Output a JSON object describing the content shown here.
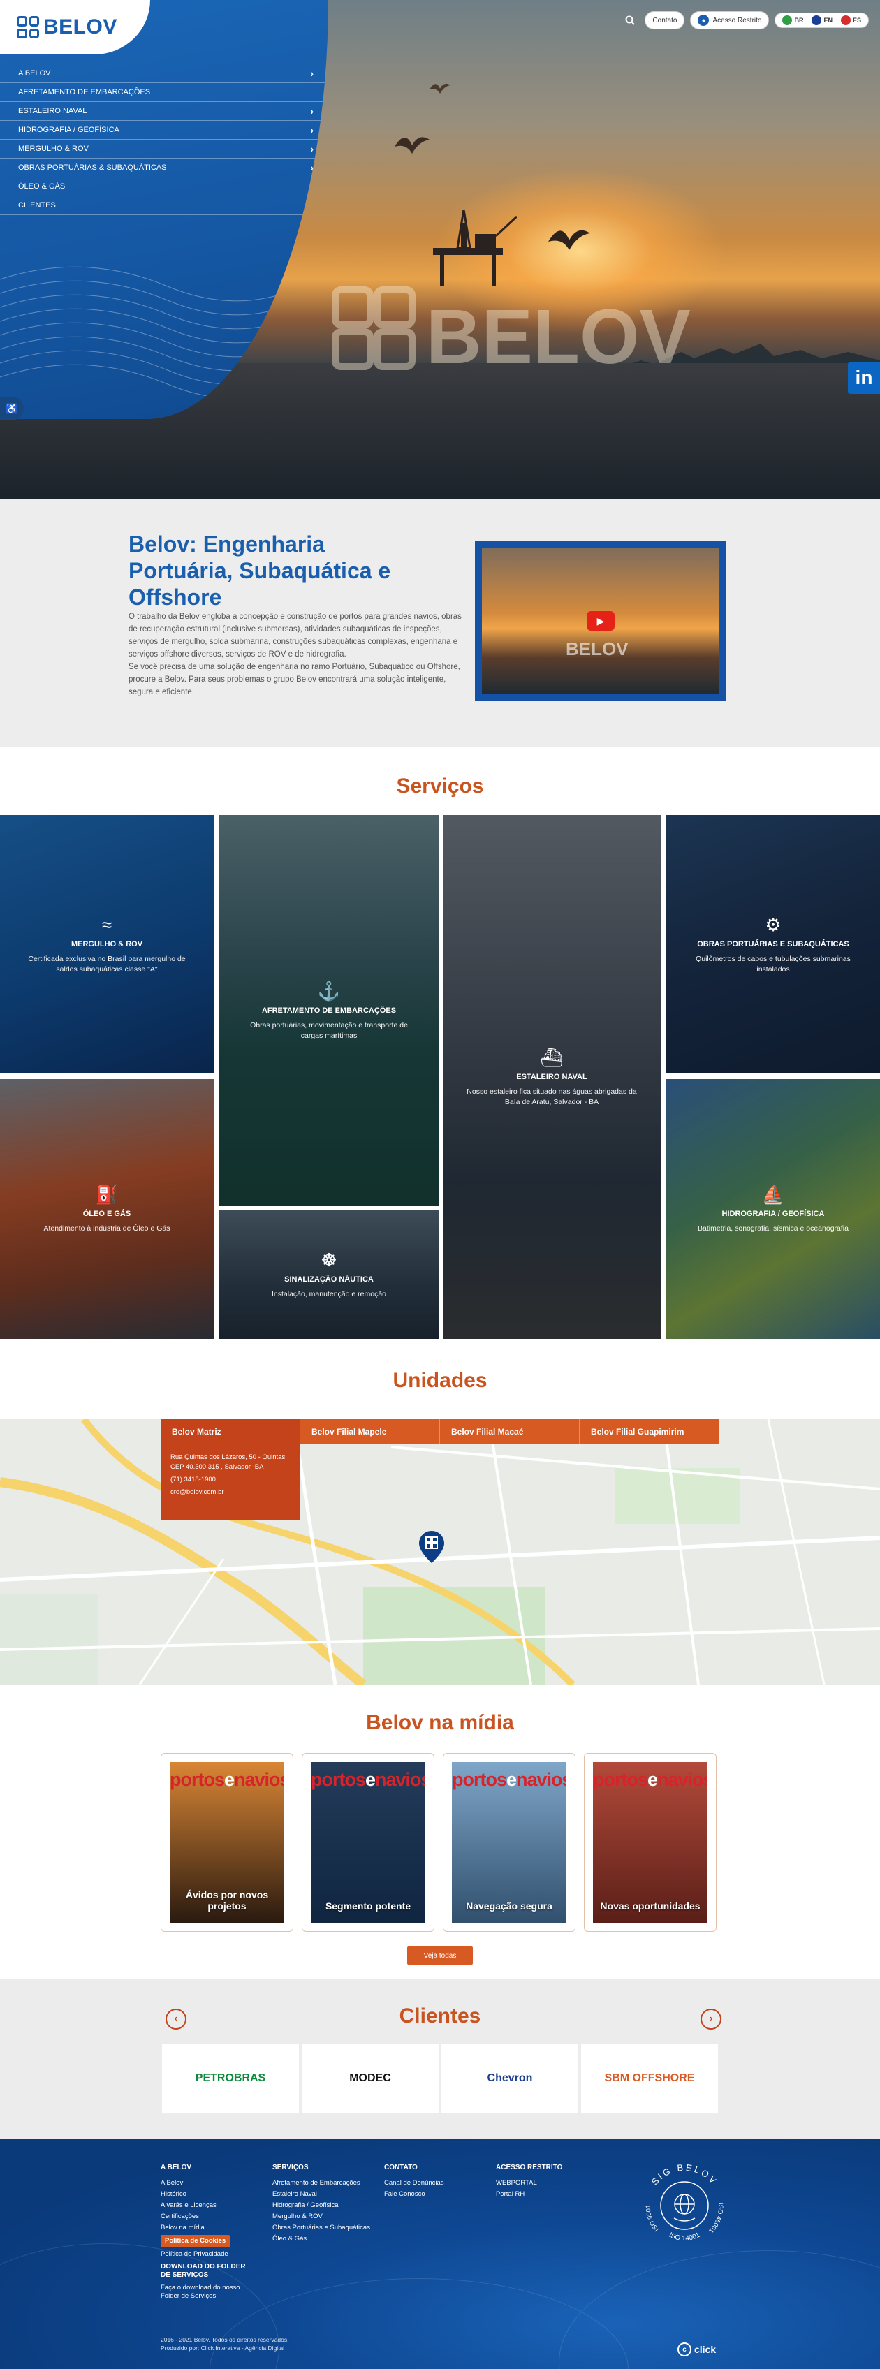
{
  "header": {
    "logo_text": "BELOV",
    "contact_label": "Contato",
    "restricted_label": "Acesso Restrito",
    "languages": [
      {
        "code": "BR",
        "color": "#2f9e44"
      },
      {
        "code": "EN",
        "color": "#1c3f94"
      },
      {
        "code": "ES",
        "color": "#d32f2f"
      }
    ]
  },
  "side_menu": [
    {
      "label": "A Belov",
      "has_children": true
    },
    {
      "label": "Afretamento de Embarcações",
      "has_children": false
    },
    {
      "label": "Estaleiro Naval",
      "has_children": true
    },
    {
      "label": "Hidrografia / Geofísica",
      "has_children": true
    },
    {
      "label": "Mergulho & ROV",
      "has_children": true
    },
    {
      "label": "Obras Portuárias & Subaquáticas",
      "has_children": true
    },
    {
      "label": "Óleo & Gás",
      "has_children": true
    },
    {
      "label": "Clientes",
      "has_children": false
    }
  ],
  "hero": {
    "watermark": "BELOV",
    "linkedin": "in"
  },
  "intro": {
    "title": "Belov: Engenharia Portuária, Subaquática e Offshore",
    "paragraph_1": "O trabalho da Belov engloba a concepção e construção de portos para grandes navios, obras de recuperação estrutural (inclusive submersas), atividades subaquáticas de inspeções, serviços de mergulho, solda submarina, construções subaquáticas complexas, engenharia e serviços offshore diversos, serviços de ROV e de hidrografia.",
    "paragraph_2": "Se você precisa de uma solução de engenharia no ramo Portuário, Subaquático ou Offshore, procure a Belov. Para seus problemas o grupo Belov encontrará uma solução inteligente, segura e eficiente.",
    "video_watermark": "BELOV"
  },
  "services": {
    "title": "Serviços",
    "tiles": [
      {
        "title": "Mergulho & ROV",
        "desc": "Certificada exclusiva no Brasil para mergulho de saldos subaquáticas classe \"A\"",
        "icon": "≈"
      },
      {
        "title": "Afretamento de Embarcações",
        "desc": "Obras portuárias, movimentação e transporte de cargas marítimas",
        "icon": "⚓"
      },
      {
        "title": "Estaleiro Naval",
        "desc": "Nosso estaleiro fica situado nas águas abrigadas da Baía de Aratu, Salvador - BA",
        "icon": "⛴"
      },
      {
        "title": "Obras Portuárias e Subaquáticas",
        "desc": "Quilômetros de cabos e tubulações submarinas instalados",
        "icon": "⚙"
      },
      {
        "title": "Óleo e Gás",
        "desc": "Atendimento à indústria de Óleo e Gás",
        "icon": "⛽"
      },
      {
        "title": "Sinalização Náutica",
        "desc": "Instalação, manutenção e remoção",
        "icon": "☸"
      },
      {
        "title": "Hidrografia / Geofísica",
        "desc": "Batimetria, sonografia, sísmica e oceanografia",
        "icon": "⛵"
      }
    ]
  },
  "units": {
    "title": "Unidades",
    "tabs": [
      "Belov Matriz",
      "Belov Filial Mapele",
      "Belov Filial Macaé",
      "Belov Filial Guapimirim"
    ],
    "active_address": "Rua Quintas dos Lázaros, 50 - Quintas CEP 40.300 315 , Salvador -BA",
    "active_phone": "(71) 3418-1900",
    "active_email": "cre@belov.com.br"
  },
  "media": {
    "title": "Belov na mídia",
    "magazine_name_a": "portos",
    "magazine_name_e": "e",
    "magazine_name_b": "navios",
    "covers": [
      {
        "caption": "Ávidos por novos projetos",
        "color_top": "#d98635",
        "color_bottom": "#2a1a10"
      },
      {
        "caption": "Segmento potente",
        "color_top": "#243c5a",
        "color_bottom": "#0f2540"
      },
      {
        "caption": "Navegação segura",
        "color_top": "#7fa6c8",
        "color_bottom": "#31506e"
      },
      {
        "caption": "Novas oportunidades",
        "color_top": "#b34a3a",
        "color_bottom": "#5a1f18"
      }
    ],
    "see_all_label": "Veja todas"
  },
  "clients": {
    "title": "Clientes",
    "logos": [
      {
        "name": "PETROBRAS",
        "color": "#0a8a3a"
      },
      {
        "name": "MODEC",
        "color": "#111111"
      },
      {
        "name": "Chevron",
        "color": "#1b3f8f"
      },
      {
        "name": "SBM OFFSHORE",
        "color": "#d65a22"
      }
    ]
  },
  "footer": {
    "col1": {
      "heading": "A BELOV",
      "items": [
        "A Belov",
        "Histórico",
        "Alvarás e Licenças",
        "Certificações",
        "Belov na mídia"
      ],
      "cookie_label": "Política de Cookies",
      "privacy": "Política de Privacidade",
      "download_heading": "DOWNLOAD DO FOLDER DE SERVIÇOS",
      "download_text": "Faça o download do nosso Folder de Serviços"
    },
    "col2": {
      "heading": "SERVIÇOS",
      "items": [
        "Afretamento de Embarcações",
        "Estaleiro Naval",
        "Hidrografia / Geofísica",
        "Mergulho & ROV",
        "Obras Portuárias e Subaquáticas",
        "Óleo & Gás"
      ]
    },
    "col3": {
      "heading": "CONTATO",
      "items": [
        "Canal de Denúncias",
        "Fale Conosco"
      ]
    },
    "col4": {
      "heading": "ACESSO RESTRITO",
      "items": [
        "WEBPORTAL",
        "Portal RH"
      ]
    },
    "seal_top": "SIG BELOV",
    "seal_left": "ISO 9001",
    "seal_right": "ISO 45001",
    "seal_bottom": "ISO 14001",
    "copyright_1": "2016 - 2021 Belov. Todos os direitos reservados.",
    "copyright_2": "Produzido por: Click Interativa - Agência Digital",
    "agency": "click"
  }
}
